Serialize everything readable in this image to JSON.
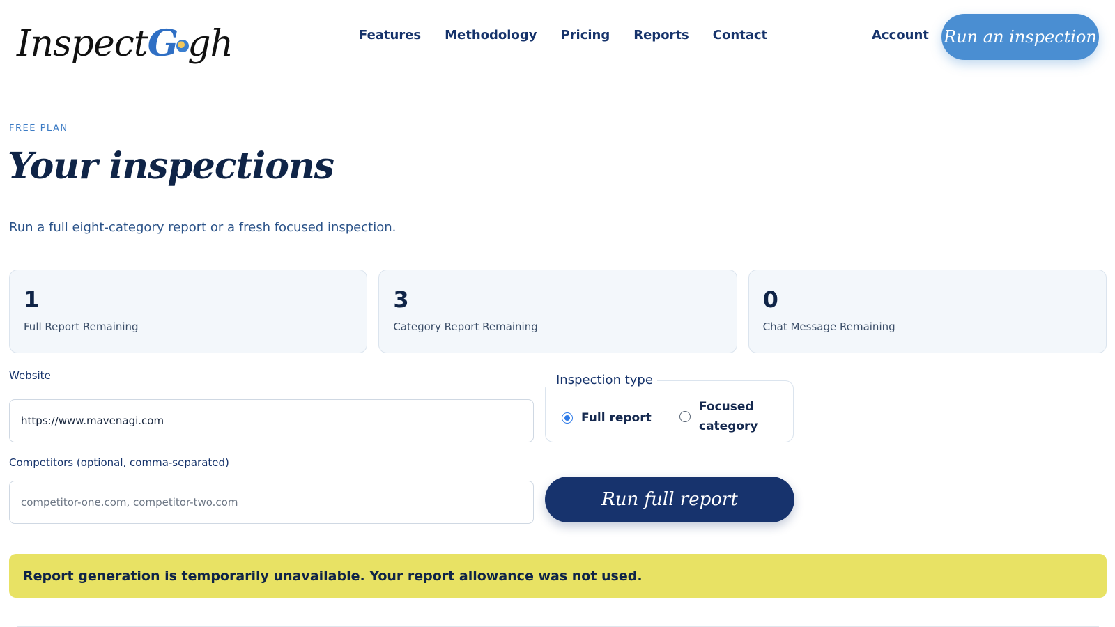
{
  "header": {
    "logo_text_a": "Inspect",
    "logo_text_g": "G",
    "logo_text_b": "gh",
    "nav": [
      "Features",
      "Methodology",
      "Pricing",
      "Reports",
      "Contact"
    ],
    "account_label": "Account",
    "cta_label": "Run an inspection"
  },
  "hero": {
    "eyebrow": "FREE PLAN",
    "title": "Your inspections",
    "subtitle": "Run a full eight-category report or a fresh focused inspection."
  },
  "stats": [
    {
      "value": "1",
      "label": "Full Report Remaining"
    },
    {
      "value": "3",
      "label": "Category Report Remaining"
    },
    {
      "value": "0",
      "label": "Chat Message Remaining"
    }
  ],
  "form": {
    "website_label": "Website",
    "website_value": "https://www.mavenagi.com",
    "competitors_label": "Competitors (optional, comma-separated)",
    "competitors_placeholder": "competitor-one.com, competitor-two.com",
    "inspection_type_label": "Inspection type",
    "options": [
      {
        "label": "Full report",
        "selected": true
      },
      {
        "label_line1": "Focused",
        "label_line2": "category",
        "selected": false
      }
    ],
    "submit_label": "Run full report"
  },
  "alert": {
    "message": "Report generation is temporarily unavailable. Your report allowance was not used.",
    "color": "#e8e264"
  },
  "colors": {
    "brand_navy": "#17336d",
    "accent_blue": "#4a8ed2"
  }
}
